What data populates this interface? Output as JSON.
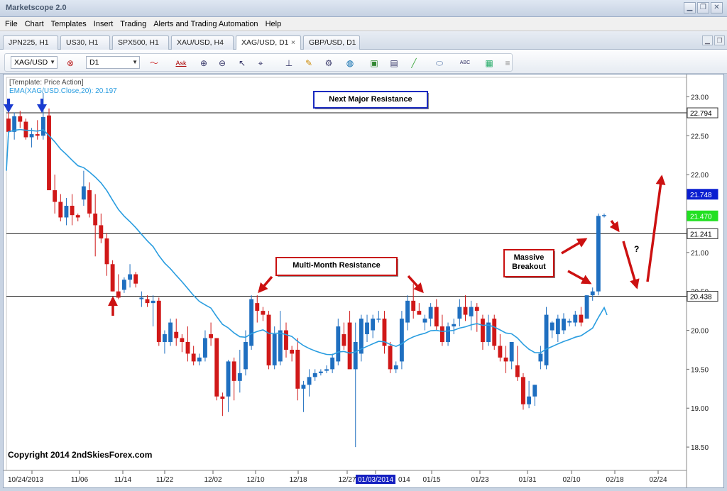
{
  "app": {
    "title": "Marketscope 2.0"
  },
  "menu": [
    "File",
    "Chart",
    "Templates",
    "Insert",
    "Trading",
    "Alerts and Trading Automation",
    "Help"
  ],
  "tabs": [
    {
      "label": "JPN225, H1",
      "active": false
    },
    {
      "label": "US30, H1",
      "active": false
    },
    {
      "label": "SPX500, H1",
      "active": false
    },
    {
      "label": "XAU/USD, H4",
      "active": false
    },
    {
      "label": "XAG/USD, D1",
      "active": true,
      "close": "×"
    },
    {
      "label": "GBP/USD, D1",
      "active": false
    }
  ],
  "toolbar": {
    "symbol": "XAG/USD",
    "timeframe": "D1",
    "ask_label": "Ask"
  },
  "chart": {
    "template_label": "[Template: Price Action]",
    "ema_label": "EMA(XAG/USD.Close,20): 20.197",
    "copyright": "Copyright 2014 2ndSkiesForex.com",
    "annotations": {
      "next_major": "Next Major Resistance",
      "multi_month": "Multi-Month Resistance",
      "massive_line1": "Massive",
      "massive_line2": "Breakout",
      "question": "?"
    },
    "price_labels": [
      {
        "value": "22.794",
        "style": "line"
      },
      {
        "value": "21.748",
        "style": "blue"
      },
      {
        "value": "21.470",
        "style": "green"
      },
      {
        "value": "21.241",
        "style": "line"
      },
      {
        "value": "20.438",
        "style": "line"
      }
    ],
    "date_highlight": "01/03/2014",
    "colors": {
      "bull": "#1f6fc0",
      "bear": "#d01818",
      "ema": "#2a9de0",
      "arrow_red": "#cc1111",
      "arrow_blue": "#1a3bd0"
    }
  },
  "chart_data": {
    "type": "candlestick",
    "symbol": "XAG/USD",
    "timeframe": "D1",
    "y_ticks": [
      "23.00",
      "22.50",
      "22.00",
      "21.50",
      "21.00",
      "20.50",
      "20.00",
      "19.50",
      "19.00",
      "18.50"
    ],
    "ylim": [
      18.2,
      23.25
    ],
    "x_ticks": [
      "10/24/2013",
      "11/06",
      "11/14",
      "11/22",
      "12/02",
      "12/10",
      "12/18",
      "12/27",
      "01/03/2014",
      "01/15",
      "01/23",
      "01/31",
      "02/10",
      "02/18",
      "02/24"
    ],
    "horizontal_levels": [
      22.794,
      21.241,
      20.438
    ],
    "candles": [
      [
        22.72,
        22.85,
        22.48,
        22.55
      ],
      [
        22.55,
        22.8,
        22.45,
        22.75
      ],
      [
        22.75,
        22.82,
        22.6,
        22.68
      ],
      [
        22.68,
        22.72,
        22.45,
        22.48
      ],
      [
        22.48,
        22.6,
        22.35,
        22.52
      ],
      [
        22.52,
        22.7,
        22.45,
        22.5
      ],
      [
        22.5,
        23.05,
        22.45,
        22.74
      ],
      [
        22.76,
        22.85,
        22.1,
        21.8
      ],
      [
        21.8,
        22.0,
        21.5,
        21.65
      ],
      [
        21.65,
        21.75,
        21.4,
        21.45
      ],
      [
        21.45,
        21.7,
        21.35,
        21.6
      ],
      [
        21.6,
        21.75,
        21.35,
        21.48
      ],
      [
        21.48,
        21.5,
        21.4,
        21.45
      ],
      [
        21.68,
        22.05,
        21.6,
        21.85
      ],
      [
        21.8,
        21.9,
        21.45,
        21.5
      ],
      [
        21.5,
        21.75,
        20.95,
        21.35
      ],
      [
        21.35,
        21.5,
        21.12,
        21.18
      ],
      [
        21.18,
        21.25,
        20.7,
        20.85
      ],
      [
        20.85,
        20.9,
        20.5,
        20.5
      ],
      [
        20.5,
        20.72,
        20.4,
        20.42
      ],
      [
        20.52,
        20.68,
        20.48,
        20.65
      ],
      [
        20.65,
        20.85,
        20.55,
        20.72
      ],
      [
        20.72,
        20.75,
        20.55,
        20.6
      ],
      [
        20.4,
        20.5,
        20.3,
        20.42
      ],
      [
        20.4,
        20.45,
        20.3,
        20.35
      ],
      [
        20.35,
        20.45,
        20.05,
        20.38
      ],
      [
        20.38,
        20.42,
        19.8,
        19.85
      ],
      [
        19.85,
        20.0,
        19.7,
        19.95
      ],
      [
        19.85,
        20.15,
        19.8,
        20.1
      ],
      [
        19.98,
        20.15,
        19.8,
        19.9
      ],
      [
        19.9,
        19.95,
        19.72,
        19.85
      ],
      [
        19.85,
        20.05,
        19.6,
        19.7
      ],
      [
        19.7,
        19.8,
        19.55,
        19.6
      ],
      [
        19.6,
        19.7,
        19.55,
        19.65
      ],
      [
        19.65,
        20.0,
        19.6,
        19.9
      ],
      [
        19.95,
        20.1,
        19.8,
        19.9
      ],
      [
        19.9,
        19.9,
        19.1,
        19.15
      ],
      [
        19.15,
        19.2,
        18.9,
        19.12
      ],
      [
        19.15,
        19.62,
        18.95,
        19.6
      ],
      [
        19.6,
        19.65,
        19.1,
        19.35
      ],
      [
        19.35,
        19.75,
        19.2,
        19.45
      ],
      [
        19.5,
        20.0,
        19.42,
        19.85
      ],
      [
        19.8,
        20.45,
        19.75,
        20.4
      ],
      [
        20.35,
        20.45,
        20.1,
        20.25
      ],
      [
        20.25,
        20.3,
        20.12,
        20.2
      ],
      [
        20.2,
        20.25,
        19.5,
        19.55
      ],
      [
        19.55,
        20.05,
        19.5,
        19.95
      ],
      [
        19.6,
        20.25,
        19.55,
        20.0
      ],
      [
        20.0,
        20.1,
        19.65,
        19.75
      ],
      [
        19.75,
        19.8,
        19.6,
        19.7
      ],
      [
        19.75,
        19.9,
        19.1,
        19.25
      ],
      [
        19.25,
        19.35,
        18.95,
        19.3
      ],
      [
        19.3,
        19.5,
        19.15,
        19.4
      ],
      [
        19.4,
        19.5,
        19.35,
        19.45
      ],
      [
        19.45,
        19.5,
        19.42,
        19.47
      ],
      [
        19.48,
        19.55,
        19.45,
        19.5
      ],
      [
        19.5,
        19.7,
        19.45,
        19.65
      ],
      [
        19.6,
        20.15,
        19.55,
        20.05
      ],
      [
        19.95,
        20.1,
        19.75,
        19.8
      ],
      [
        20.1,
        20.25,
        19.55,
        19.5
      ],
      [
        19.5,
        20.1,
        18.5,
        19.85
      ],
      [
        19.7,
        20.2,
        19.6,
        20.15
      ],
      [
        19.95,
        20.2,
        19.85,
        20.1
      ],
      [
        20.0,
        20.2,
        19.9,
        20.15
      ],
      [
        20.15,
        20.25,
        20.1,
        20.15
      ],
      [
        20.15,
        20.25,
        19.7,
        19.8
      ],
      [
        19.8,
        19.85,
        19.45,
        19.5
      ],
      [
        19.5,
        19.6,
        19.45,
        19.55
      ],
      [
        19.6,
        20.25,
        19.5,
        20.15
      ],
      [
        20.1,
        20.45,
        20.0,
        20.38
      ],
      [
        20.38,
        20.6,
        20.15,
        20.25
      ],
      [
        20.25,
        20.35,
        20.2,
        20.2
      ],
      [
        20.1,
        20.2,
        20.0,
        20.15
      ],
      [
        20.15,
        20.35,
        20.05,
        20.3
      ],
      [
        20.3,
        20.4,
        20.0,
        20.05
      ],
      [
        20.05,
        20.2,
        19.8,
        19.85
      ],
      [
        19.85,
        20.1,
        19.8,
        20.05
      ],
      [
        20.05,
        20.15,
        19.95,
        20.08
      ],
      [
        20.15,
        20.4,
        20.05,
        20.3
      ],
      [
        20.3,
        20.45,
        20.12,
        20.2
      ],
      [
        20.18,
        20.38,
        20.0,
        20.3
      ],
      [
        20.3,
        20.35,
        19.98,
        20.25
      ],
      [
        20.15,
        20.2,
        19.75,
        19.85
      ],
      [
        19.85,
        20.2,
        19.8,
        20.1
      ],
      [
        20.15,
        20.2,
        19.75,
        19.8
      ],
      [
        19.8,
        19.95,
        19.6,
        19.65
      ],
      [
        19.65,
        19.8,
        19.45,
        19.6
      ],
      [
        19.6,
        19.85,
        19.5,
        19.85
      ],
      [
        19.55,
        19.8,
        19.35,
        19.4
      ],
      [
        19.4,
        19.45,
        18.98,
        19.05
      ],
      [
        19.05,
        19.35,
        19.0,
        19.15
      ],
      [
        19.15,
        19.3,
        19.03,
        19.3
      ],
      [
        19.6,
        19.8,
        19.5,
        19.7
      ],
      [
        19.55,
        20.3,
        19.5,
        20.2
      ],
      [
        20.0,
        20.12,
        19.9,
        20.1
      ],
      [
        19.95,
        20.2,
        19.85,
        20.15
      ],
      [
        20.0,
        20.22,
        19.95,
        20.15
      ],
      [
        20.1,
        20.15,
        20.05,
        20.12
      ],
      [
        20.1,
        20.25,
        20.05,
        20.2
      ],
      [
        20.2,
        20.3,
        20.05,
        20.1
      ],
      [
        20.15,
        20.45,
        20.15,
        20.45
      ],
      [
        20.45,
        20.55,
        20.38,
        20.5
      ],
      [
        20.5,
        21.5,
        20.45,
        21.47
      ],
      [
        21.47,
        21.5,
        21.45,
        21.48
      ]
    ],
    "ema20_level": 20.197
  }
}
